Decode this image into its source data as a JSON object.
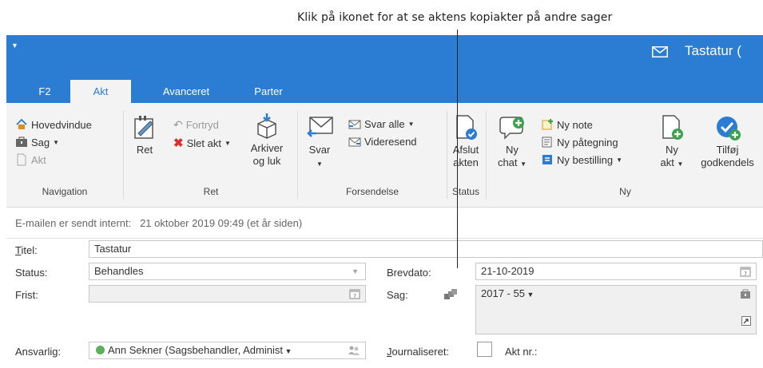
{
  "callout": {
    "text": "Klik på ikonet for at se aktens kopiakter på andre sager"
  },
  "window": {
    "title": "Tastatur ("
  },
  "tabs": [
    "F2",
    "Akt",
    "Avanceret",
    "Parter"
  ],
  "ribbon": {
    "navigation": {
      "hovedvindue": "Hovedvindue",
      "sag": "Sag",
      "akt": "Akt",
      "group": "Navigation"
    },
    "ret": {
      "ret": "Ret",
      "fortryd": "Fortryd",
      "slet_akt": "Slet akt",
      "arkiver_line1": "Arkiver",
      "arkiver_line2": "og luk",
      "group": "Ret"
    },
    "forsendelse": {
      "svar": "Svar",
      "svar_alle": "Svar alle",
      "videresend": "Videresend",
      "group": "Forsendelse"
    },
    "status": {
      "afslut_line1": "Afslut",
      "afslut_line2": "akten",
      "group": "Status"
    },
    "ny": {
      "ny_chat_line1": "Ny",
      "ny_chat_line2": "chat",
      "ny_note": "Ny note",
      "ny_paategning": "Ny påtegning",
      "ny_bestilling": "Ny bestilling",
      "ny_akt_line1": "Ny",
      "ny_akt_line2": "akt",
      "tilfoej_line1": "Tilføj",
      "tilfoej_line2": "godkendels",
      "group": "Ny"
    }
  },
  "info": {
    "prefix": "E-mailen er sendt internt:",
    "date": "21 oktober 2019 09:49 (et år siden)"
  },
  "form": {
    "titel_label": "Titel:",
    "titel_value": "Tastatur",
    "status_label": "Status:",
    "status_value": "Behandles",
    "frist_label": "Frist:",
    "frist_value": "",
    "ansvarlig_label": "Ansvarlig:",
    "ansvarlig_value": "Ann Sekner (Sagsbehandler, Administ",
    "brevdato_label": "Brevdato:",
    "brevdato_value": "21-10-2019",
    "sag_label": "Sag:",
    "sag_value": "2017 - 55",
    "journaliseret_label": "Journaliseret:",
    "akt_nr_label": "Akt nr.:"
  },
  "colors": {
    "accent": "#2b7cd3",
    "ribbon_bg": "#f3f3f3",
    "status_green": "#5bb15b"
  }
}
